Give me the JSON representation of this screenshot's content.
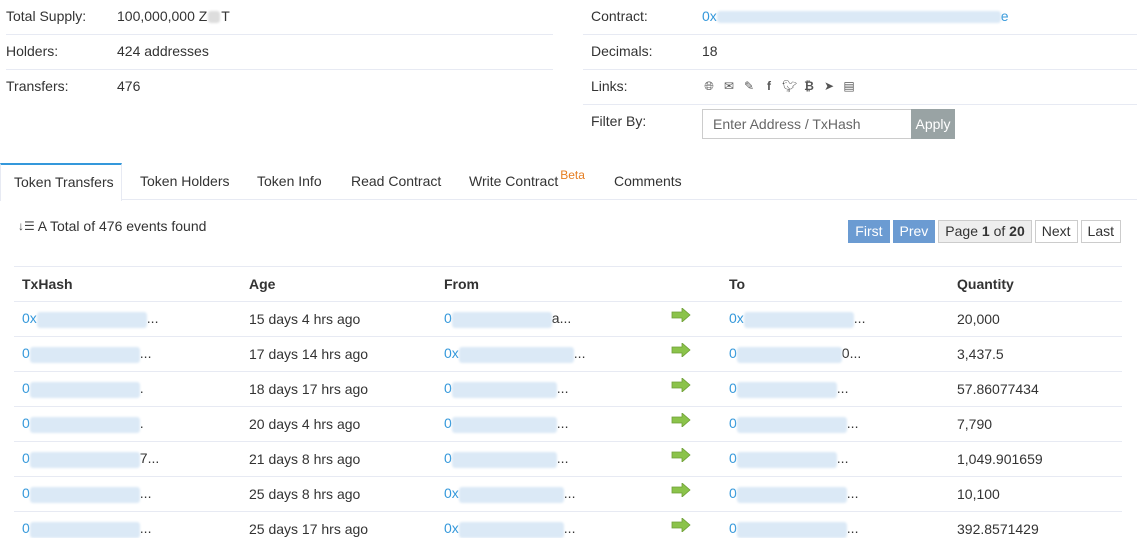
{
  "overview": {
    "left": [
      {
        "label": "Total Supply:",
        "value": "100,000,000 Z",
        "value_suffix": "T"
      },
      {
        "label": "Holders:",
        "value": "424 addresses"
      },
      {
        "label": "Transfers:",
        "value": "476"
      }
    ],
    "right": {
      "contract_label": "Contract:",
      "contract_prefix": "0x",
      "contract_suffix": "e",
      "decimals_label": "Decimals:",
      "decimals_value": "18",
      "links_label": "Links:",
      "links_icons": [
        "globe-icon",
        "email-icon",
        "edit-icon",
        "facebook-icon",
        "twitter-icon",
        "bitcoin-icon",
        "telegram-icon",
        "document-icon"
      ],
      "filter_label": "Filter By:",
      "filter_placeholder": "Enter Address / TxHash",
      "apply_label": "Apply"
    }
  },
  "tabs": [
    {
      "label": "Token Transfers",
      "active": true
    },
    {
      "label": "Token Holders"
    },
    {
      "label": "Token Info"
    },
    {
      "label": "Read Contract"
    },
    {
      "label": "Write Contract",
      "badge": "Beta"
    },
    {
      "label": "Comments"
    }
  ],
  "summary": {
    "text": "A Total of 476 events found"
  },
  "pager": {
    "first": "First",
    "prev": "Prev",
    "page_label": "Page",
    "current": "1",
    "of": "of",
    "total": "20",
    "next": "Next",
    "last": "Last"
  },
  "table": {
    "headers": [
      "TxHash",
      "Age",
      "From",
      "To",
      "Quantity"
    ],
    "rows": [
      {
        "tx_prefix": "0x",
        "tx_suffix": "...",
        "age": "15 days 4 hrs ago",
        "from_prefix": "0",
        "from_suffix": "a...",
        "to_prefix": "0x",
        "to_suffix": "...",
        "quantity": "20,000"
      },
      {
        "tx_prefix": "0",
        "tx_suffix": "...",
        "age": "17 days 14 hrs ago",
        "from_prefix": "0x",
        "from_suffix": "...",
        "to_prefix": "0",
        "to_suffix": "0...",
        "quantity": "3,437.5"
      },
      {
        "tx_prefix": "0",
        "tx_suffix": ".",
        "age": "18 days 17 hrs ago",
        "from_prefix": "0",
        "from_suffix": "...",
        "to_prefix": "0",
        "to_suffix": "...",
        "quantity": "57.86077434"
      },
      {
        "tx_prefix": "0",
        "tx_suffix": ".",
        "age": "20 days 4 hrs ago",
        "from_prefix": "0",
        "from_suffix": "...",
        "to_prefix": "0",
        "to_suffix": "...",
        "quantity": "7,790"
      },
      {
        "tx_prefix": "0",
        "tx_suffix": "7...",
        "age": "21 days 8 hrs ago",
        "from_prefix": "0",
        "from_suffix": "...",
        "to_prefix": "0",
        "to_suffix": "...",
        "quantity": "1,049.901659"
      },
      {
        "tx_prefix": "0",
        "tx_suffix": "...",
        "age": "25 days 8 hrs ago",
        "from_prefix": "0x",
        "from_suffix": "...",
        "to_prefix": "0",
        "to_suffix": "...",
        "quantity": "10,100"
      },
      {
        "tx_prefix": "0",
        "tx_suffix": "...",
        "age": "25 days 17 hrs ago",
        "from_prefix": "0x",
        "from_suffix": "...",
        "to_prefix": "0",
        "to_suffix": "...",
        "quantity": "392.8571429"
      }
    ]
  },
  "colors": {
    "link": "#3498db",
    "arrow": "#8bc34a",
    "pager_primary": "#6b9bd2",
    "apply": "#99a3a4",
    "beta": "#e67e22"
  }
}
